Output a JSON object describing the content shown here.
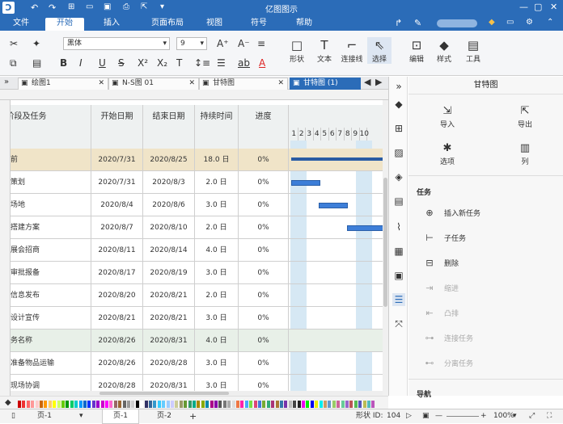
{
  "app": {
    "title": "亿图图示"
  },
  "menu": [
    {
      "label": "文件",
      "active": false
    },
    {
      "label": "开始",
      "active": true
    },
    {
      "label": "插入",
      "active": false
    },
    {
      "label": "页面布局",
      "active": false
    },
    {
      "label": "视图",
      "active": false
    },
    {
      "label": "符号",
      "active": false
    },
    {
      "label": "帮助",
      "active": false
    }
  ],
  "ribbon": {
    "font_name": "黑体",
    "font_size": "9",
    "shape": "形状",
    "text": "文本",
    "connector": "连接线",
    "select": "选择",
    "edit": "编辑",
    "style": "样式",
    "tools": "工具"
  },
  "doc_tabs": [
    {
      "label": "绘图1",
      "active": false
    },
    {
      "label": "N-S图 01",
      "active": false
    },
    {
      "label": "甘特图",
      "active": false
    },
    {
      "label": "甘特图 (1)",
      "active": true
    }
  ],
  "table": {
    "headers": [
      "阶段及任务",
      "开始日期",
      "结束日期",
      "持续时间",
      "进度"
    ],
    "gantt_days": [
      "1",
      "2",
      "3",
      "4",
      "5",
      "6",
      "7",
      "8",
      "9",
      "10"
    ],
    "rows": [
      {
        "task": "前",
        "start": "2020/7/31",
        "end": "2020/8/25",
        "duration": "18.0 日",
        "progress": "0%",
        "summary": true
      },
      {
        "task": "策划",
        "start": "2020/7/31",
        "end": "2020/8/3",
        "duration": "2.0 日",
        "progress": "0%"
      },
      {
        "task": "场地",
        "start": "2020/8/4",
        "end": "2020/8/6",
        "duration": "3.0 日",
        "progress": "0%"
      },
      {
        "task": "搭建方案",
        "start": "2020/8/7",
        "end": "2020/8/10",
        "duration": "2.0 日",
        "progress": "0%"
      },
      {
        "task": "展会招商",
        "start": "2020/8/11",
        "end": "2020/8/14",
        "duration": "4.0 日",
        "progress": "0%"
      },
      {
        "task": "审批报备",
        "start": "2020/8/17",
        "end": "2020/8/19",
        "duration": "3.0 日",
        "progress": "0%"
      },
      {
        "task": "信息发布",
        "start": "2020/8/20",
        "end": "2020/8/21",
        "duration": "2.0 日",
        "progress": "0%"
      },
      {
        "task": "设计宣传",
        "start": "2020/8/21",
        "end": "2020/8/21",
        "duration": "3.0 日",
        "progress": "0%"
      },
      {
        "task": "务名称",
        "start": "2020/8/26",
        "end": "2020/8/31",
        "duration": "4.0 日",
        "progress": "0%",
        "summary2": true
      },
      {
        "task": "准备物品运输",
        "start": "2020/8/26",
        "end": "2020/8/28",
        "duration": "3.0 日",
        "progress": "0%"
      },
      {
        "task": "现场协调",
        "start": "2020/8/28",
        "end": "2020/8/31",
        "duration": "3.0 日",
        "progress": "0%"
      }
    ]
  },
  "panel": {
    "title": "甘特图",
    "import": "导入",
    "export": "导出",
    "options": "选项",
    "columns": "列",
    "task_section": "任务",
    "tasks": [
      {
        "label": "插入新任务",
        "enabled": true,
        "icon": "insert-task-icon"
      },
      {
        "label": "子任务",
        "enabled": true,
        "icon": "subtask-icon"
      },
      {
        "label": "删除",
        "enabled": true,
        "icon": "delete-icon"
      },
      {
        "label": "缩进",
        "enabled": false,
        "icon": "indent-icon"
      },
      {
        "label": "凸排",
        "enabled": false,
        "icon": "outdent-icon"
      },
      {
        "label": "连接任务",
        "enabled": false,
        "icon": "link-task-icon"
      },
      {
        "label": "分离任务",
        "enabled": false,
        "icon": "unlink-task-icon"
      }
    ],
    "nav_section": "导航"
  },
  "status": {
    "page_left": "页-1",
    "page_tab1": "页-1",
    "page_tab2": "页-2",
    "add": "+",
    "shape_id_label": "形状 ID:",
    "shape_id": "104",
    "zoom": "100%"
  }
}
